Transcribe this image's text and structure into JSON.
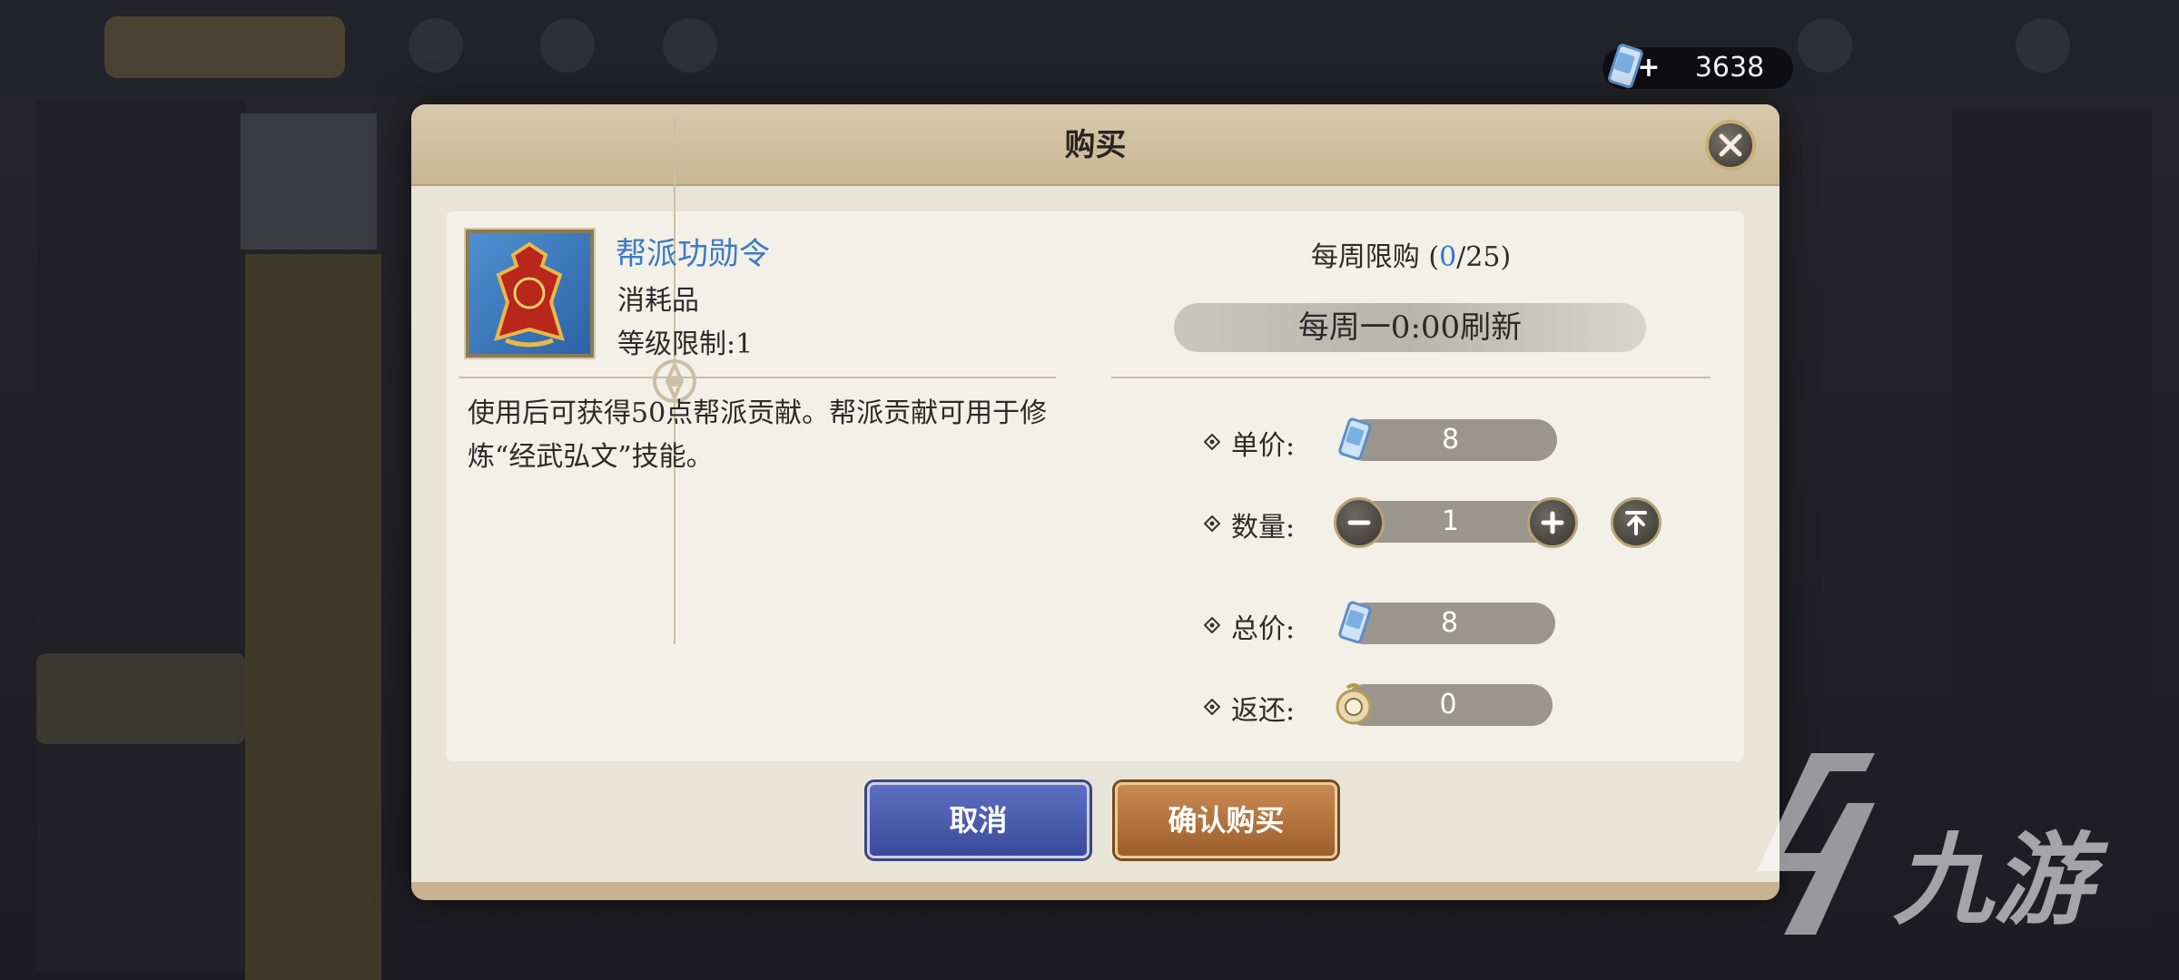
{
  "currency": {
    "amount": "3638",
    "icon": "scroll-currency-icon",
    "add_icon": "plus-icon"
  },
  "dialog": {
    "title": "购买",
    "close_icon": "close-icon",
    "item": {
      "name": "帮派功勋令",
      "type": "消耗品",
      "level_limit": "等级限制:1",
      "description": "使用后可获得50点帮派贡献。帮派贡献可用于修炼“经武弘文”技能。",
      "icon": "guild-token-icon"
    },
    "weekly_limit": {
      "prefix": "每周限购 (",
      "current": "0",
      "separator": "/",
      "max": "25",
      "suffix": ")"
    },
    "refresh_text": "每周一0:00刷新",
    "unit_price": {
      "label": "单价:",
      "value": "8"
    },
    "quantity": {
      "label": "数量:",
      "value": "1"
    },
    "total_price": {
      "label": "总价:",
      "value": "8"
    },
    "refund": {
      "label": "返还:",
      "value": "0"
    },
    "cancel_label": "取消",
    "confirm_label": "确认购买"
  },
  "watermark": {
    "text": "九游"
  },
  "colors": {
    "accent_blue": "#3c7bc4",
    "limit_blue": "#2f7ad0",
    "cancel_button": "#4a5bb0",
    "confirm_button": "#b3733c",
    "dialog_bg": "#e9e4d8"
  }
}
